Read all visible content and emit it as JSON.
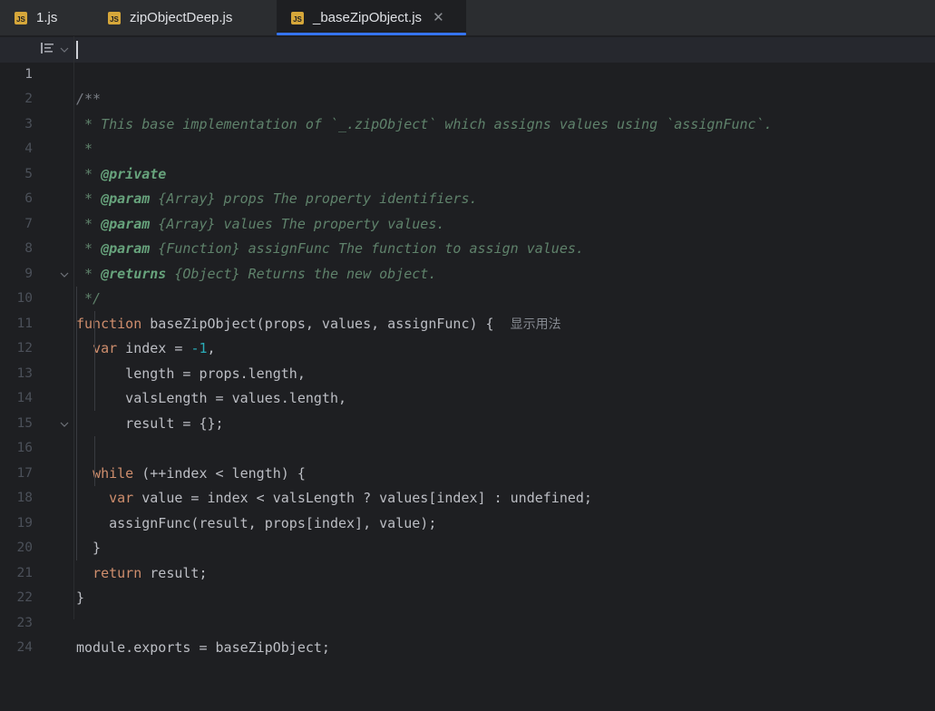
{
  "tabs": [
    {
      "icon": "JS",
      "label": "1.js"
    },
    {
      "icon": "JS",
      "label": "zipObjectDeep.js"
    },
    {
      "icon": "JS",
      "label": "_baseZipObject.js",
      "close": "✕"
    }
  ],
  "editor": {
    "line_numbers": [
      "1",
      "2",
      "3",
      "4",
      "5",
      "6",
      "7",
      "8",
      "9",
      "10",
      "11",
      "12",
      "13",
      "14",
      "15",
      "16",
      "17",
      "18",
      "19",
      "20",
      "21",
      "22",
      "23",
      "24"
    ],
    "inlay_hint": "显示用法",
    "lines": [
      [
        "/**"
      ],
      [
        " * This base implementation of `_.zipObject` which assigns values using `assignFunc`."
      ],
      [
        " *"
      ],
      [
        " * ",
        "@private"
      ],
      [
        " * ",
        "@param",
        " {Array} props The property identifiers."
      ],
      [
        " * ",
        "@param",
        " {Array} values The property values."
      ],
      [
        " * ",
        "@param",
        " {Function} assignFunc The function to assign values."
      ],
      [
        " * ",
        "@returns",
        " {Object} Returns the new object."
      ],
      [
        " */"
      ],
      [
        "function",
        " baseZipObject(props, values, assignFunc) {"
      ],
      [
        "  ",
        "var",
        " index = ",
        "-1",
        ","
      ],
      [
        "      length = props.length,"
      ],
      [
        "      valsLength = values.length,"
      ],
      [
        "      result = {};"
      ],
      [
        ""
      ],
      [
        "  ",
        "while",
        " (++index < length) {"
      ],
      [
        "    ",
        "var",
        " value = index < valsLength ? values[index] : undefined;"
      ],
      [
        "    assignFunc(result, props[index], value);"
      ],
      [
        "  }"
      ],
      [
        "  ",
        "return",
        " result;"
      ],
      [
        "}"
      ],
      [
        ""
      ],
      [
        "module.exports = baseZipObject;"
      ],
      [
        ""
      ]
    ]
  }
}
